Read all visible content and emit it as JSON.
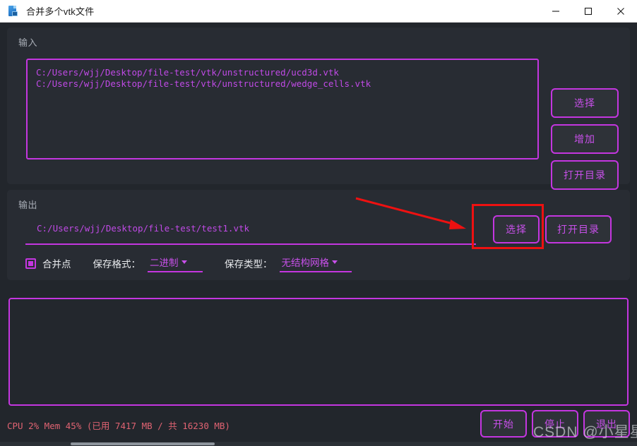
{
  "window": {
    "title": "合并多个vtk文件",
    "icon": "vtk-file-icon",
    "controls": {
      "minimize": "minimize-icon",
      "maximize": "maximize-icon",
      "close": "close-icon"
    }
  },
  "input_group": {
    "title": "输入",
    "files": [
      "C:/Users/wjj/Desktop/file-test/vtk/unstructured/ucd3d.vtk",
      "C:/Users/wjj/Desktop/file-test/vtk/unstructured/wedge_cells.vtk"
    ],
    "buttons": {
      "select": "选择",
      "add": "增加",
      "open_dir": "打开目录"
    }
  },
  "output_group": {
    "title": "输出",
    "path": "C:/Users/wjj/Desktop/file-test/test1.vtk",
    "buttons": {
      "select": "选择",
      "open_dir": "打开目录"
    },
    "options": {
      "merge_points_label": "合并点",
      "merge_points_checked": true,
      "save_format_label": "保存格式：",
      "save_format_value": "二进制",
      "save_type_label": "保存类型：",
      "save_type_value": "无结构网格"
    }
  },
  "log": {
    "content": ""
  },
  "status": {
    "text": "CPU 2% Mem 45% (已用 7417 MB / 共 16230 MB)"
  },
  "action_buttons": {
    "start": "开始",
    "stop": "停止",
    "exit": "退出"
  },
  "annotations": {
    "highlight_box_target": "output-select-button",
    "arrow_color": "#ee1111",
    "box_color": "#ee1111"
  },
  "watermark": {
    "text": "CSDN @小星星·"
  },
  "colors": {
    "accent": "#c436e0",
    "accent_text": "#c850ea",
    "path_text": "#c04ae6",
    "window_bg": "#22262c",
    "group_bg": "#282c33",
    "status_text": "#e06372",
    "titlebar_bg": "#ffffff"
  }
}
